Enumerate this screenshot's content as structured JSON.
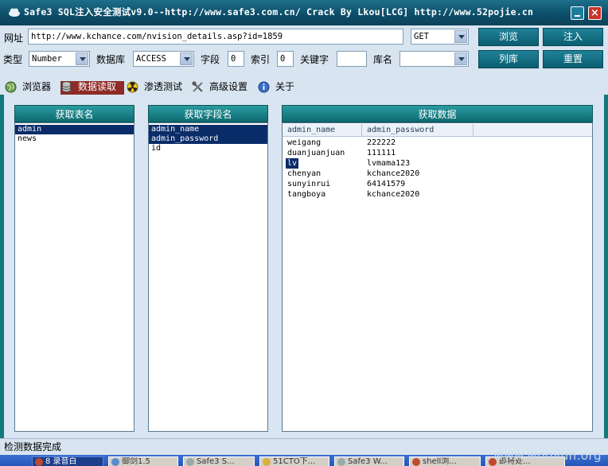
{
  "window": {
    "title": "Safe3 SQL注入安全测试v9.0--http://www.safe3.com.cn/  Crack By Lkou[LCG]  http://www.52pojie.cn"
  },
  "toolbar": {
    "url_label": "网址",
    "url_value": "http://www.kchance.com/nvision_details.asp?id=1859",
    "method_value": "GET",
    "type_label": "类型",
    "type_value": "Number",
    "db_label": "数据库",
    "db_value": "ACCESS",
    "field_label": "字段",
    "field_value": "0",
    "index_label": "索引",
    "index_value": "0",
    "keyword_label": "关键字",
    "keyword_value": "",
    "dbname_label": "库名",
    "dbname_value": "",
    "browse_label": "浏览",
    "inject_label": "注入",
    "list_db_label": "列库",
    "reset_label": "重置"
  },
  "tabs": [
    {
      "label": "浏览器",
      "icon": "globe-icon"
    },
    {
      "label": "数据读取",
      "icon": "database-icon",
      "active": true
    },
    {
      "label": "渗透测试",
      "icon": "radiation-icon"
    },
    {
      "label": "高级设置",
      "icon": "tools-icon"
    },
    {
      "label": "关于",
      "icon": "info-icon"
    }
  ],
  "tables_panel": {
    "header": "获取表名",
    "items": [
      "admin",
      "news"
    ],
    "selected": 0
  },
  "fields_panel": {
    "header": "获取字段名",
    "items": [
      "admin_name",
      "admin_password",
      "id"
    ],
    "selected": [
      0,
      1
    ]
  },
  "data_panel": {
    "header": "获取数据",
    "columns": [
      "admin_name",
      "admin_password"
    ],
    "rows": [
      [
        "weigang",
        "222222"
      ],
      [
        "duanjuanjuan",
        "111111"
      ],
      [
        "lv",
        "lvmama123"
      ],
      [
        "chenyan",
        "kchance2020"
      ],
      [
        "sunyinrui",
        "64141579"
      ],
      [
        "tangboya",
        "kchance2020"
      ]
    ],
    "selected_row": 2
  },
  "status": {
    "text": "检测数据完成"
  },
  "taskbar": {
    "items": [
      "8 录音白",
      "御剑1.5",
      "Safe3 S...",
      "51CTO下...",
      "Safe3 W...",
      "shell浏...",
      "即将处..."
    ]
  },
  "watermark": "www.woqyun.org",
  "colors": {
    "title_bar": "#0d4f6a",
    "button": "#0b5d70",
    "active_tab": "#8e2b27",
    "selection": "#0a2c68",
    "panel_header": "#1a8085"
  }
}
